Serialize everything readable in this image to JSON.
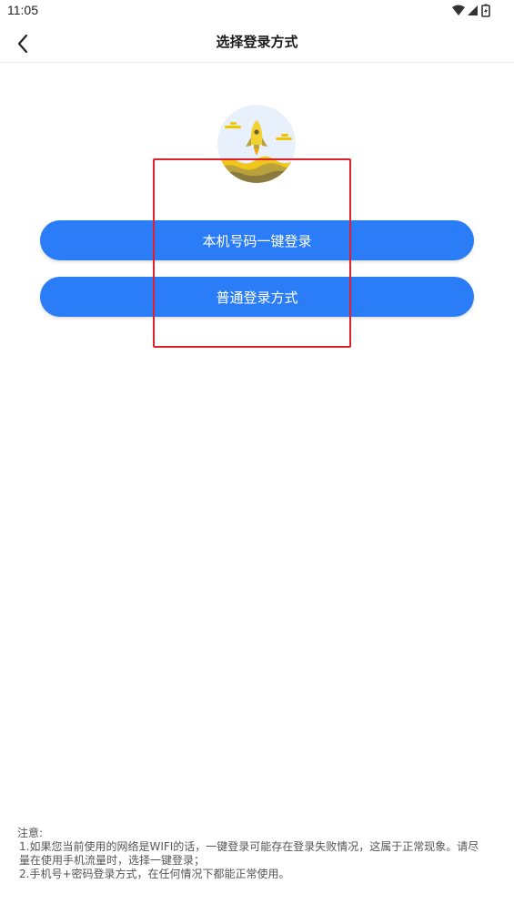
{
  "status_bar": {
    "time": "11:05",
    "icons": [
      "wifi-icon",
      "cell-signal-icon",
      "battery-charging-icon"
    ]
  },
  "nav": {
    "back_icon": "chevron-left-icon",
    "title": "选择登录方式"
  },
  "logo": {
    "icon": "rocket-launch-icon",
    "colors": {
      "sky": "#e8f0fb",
      "cloud": "#f4c400",
      "rocket": "#f2d230",
      "ground_dark": "#8a7a3e",
      "ground_mid": "#b9a23c",
      "ground_light": "#f0c51c"
    }
  },
  "buttons": {
    "one_click_label": "本机号码一键登录",
    "normal_label": "普通登录方式",
    "color": "#2a7df6"
  },
  "annotation": {
    "highlight_color": "#e0202a"
  },
  "notes": {
    "heading": "注意:",
    "item1": "1.如果您当前使用的网络是WIFI的话，一键登录可能存在登录失败情况，这属于正常现象。请尽量在使用手机流量时，选择一键登录；",
    "item2": "2.手机号+密码登录方式，在任何情况下都能正常使用。"
  }
}
